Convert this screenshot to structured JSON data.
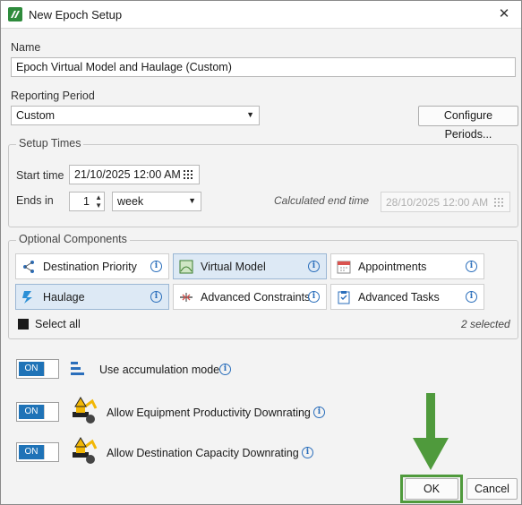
{
  "window": {
    "title": "New Epoch Setup",
    "close_glyph": "✕"
  },
  "name": {
    "label": "Name",
    "value": "Epoch Virtual Model and Haulage (Custom)"
  },
  "reporting_period": {
    "label": "Reporting Period",
    "value": "Custom",
    "configure_label": "Configure Periods..."
  },
  "setup_times": {
    "group_title": "Setup Times",
    "start_label": "Start time",
    "start_value": "21/10/2025 12:00 AM",
    "ends_label": "Ends in",
    "ends_value": "1",
    "unit_value": "week",
    "calc_label": "Calculated end time",
    "calc_value": "28/10/2025 12:00 AM"
  },
  "optional_components": {
    "group_title": "Optional Components",
    "items": [
      {
        "label": "Destination Priority",
        "icon": "destination-priority-icon",
        "selected": false
      },
      {
        "label": "Virtual Model",
        "icon": "virtual-model-icon",
        "selected": true
      },
      {
        "label": "Appointments",
        "icon": "calendar-icon",
        "selected": false
      },
      {
        "label": "Haulage",
        "icon": "haulage-icon",
        "selected": true
      },
      {
        "label": "Advanced Constraints",
        "icon": "constraints-icon",
        "selected": false
      },
      {
        "label": "Advanced Tasks",
        "icon": "tasks-icon",
        "selected": false
      }
    ],
    "select_all_label": "Select all",
    "selected_count": "2 selected"
  },
  "options": [
    {
      "toggle": "ON",
      "label": "Use accumulation mode",
      "icon": "accumulation-icon"
    },
    {
      "toggle": "ON",
      "label": "Allow Equipment Productivity Downrating",
      "icon": "excavator-icon"
    },
    {
      "toggle": "ON",
      "label": "Allow Destination Capacity Downrating",
      "icon": "excavator-icon"
    }
  ],
  "footer": {
    "ok_label": "OK",
    "cancel_label": "Cancel"
  },
  "colors": {
    "accent": "#1f73b7",
    "highlight_green": "#4f9a3c",
    "selected_bg": "#dde9f5"
  }
}
